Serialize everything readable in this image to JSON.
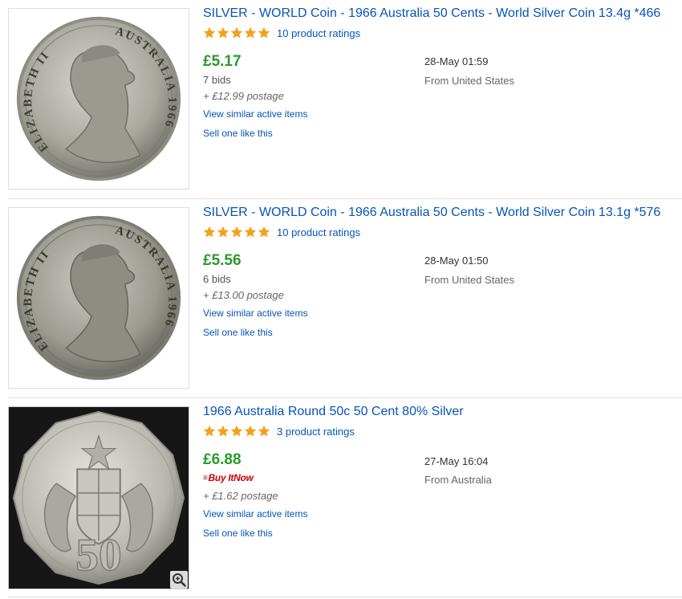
{
  "listings": [
    {
      "title": "SILVER - WORLD Coin - 1966 Australia 50 Cents - World Silver Coin 13.4g *466",
      "ratings_text": "10 product ratings",
      "stars": 5,
      "price": "£5.17",
      "bids": "7 bids",
      "postage": "+ £12.99 postage",
      "view_similar": "View similar active items",
      "sell_one": "Sell one like this",
      "date": "28-May 01:59",
      "location": "From United States",
      "coin_left_text": "ELIZABETH II",
      "coin_right_text": "AUSTRALIA 1966"
    },
    {
      "title": "SILVER - WORLD Coin - 1966 Australia 50 Cents - World Silver Coin 13.1g *576",
      "ratings_text": "10 product ratings",
      "stars": 5,
      "price": "£5.56",
      "bids": "6 bids",
      "postage": "+ £13.00 postage",
      "view_similar": "View similar active items",
      "sell_one": "Sell one like this",
      "date": "28-May 01:50",
      "location": "From United States",
      "coin_left_text": "ELIZABETH II",
      "coin_right_text": "AUSTRALIA 1966"
    },
    {
      "title": "1966 Australia Round 50c 50 Cent 80% Silver",
      "ratings_text": "3 product ratings",
      "stars": 5,
      "price": "£6.88",
      "buy_it": "Buy It",
      "buy_now": "Now",
      "postage": "+ £1.62 postage",
      "view_similar": "View similar active items",
      "sell_one": "Sell one like this",
      "date": "27-May 16:04",
      "location": "From Australia",
      "coin_value": "50"
    }
  ],
  "colors": {
    "link": "#0654ba",
    "price": "#2a9a2a",
    "star": "#f5a01a",
    "buy_it_now": "#cc0000"
  },
  "icons": {
    "rating": "star-icon",
    "zoom": "magnifier-zoom-icon"
  }
}
